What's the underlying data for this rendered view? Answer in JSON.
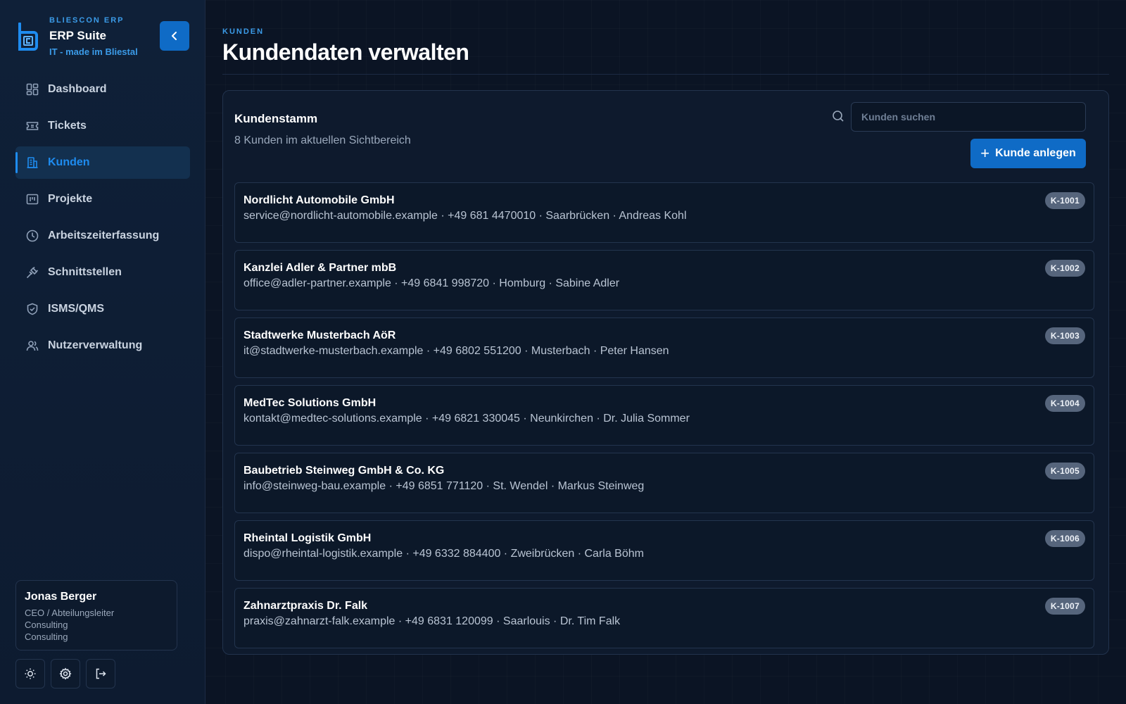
{
  "brand": {
    "company": "BLIESCON ERP",
    "product": "ERP Suite",
    "tagline": "IT - made im Bliestal"
  },
  "nav": {
    "items": [
      {
        "label": "Dashboard",
        "icon": "dashboard-grid-icon",
        "active": false
      },
      {
        "label": "Tickets",
        "icon": "ticket-icon",
        "active": false
      },
      {
        "label": "Kunden",
        "icon": "building-icon",
        "active": true
      },
      {
        "label": "Projekte",
        "icon": "project-board-icon",
        "active": false
      },
      {
        "label": "Arbeitszeiterfassung",
        "icon": "clock-icon",
        "active": false
      },
      {
        "label": "Schnittstellen",
        "icon": "plug-icon",
        "active": false
      },
      {
        "label": "ISMS/QMS",
        "icon": "shield-check-icon",
        "active": false
      },
      {
        "label": "Nutzerverwaltung",
        "icon": "users-icon",
        "active": false
      }
    ]
  },
  "user": {
    "name": "Jonas Berger",
    "role_line1": "CEO / Abteilungsleiter",
    "role_line2": "Consulting",
    "role_line3": "Consulting"
  },
  "footer_icons": [
    "sun-icon",
    "gear-icon",
    "logout-icon"
  ],
  "header": {
    "eyebrow": "KUNDEN",
    "title": "Kundendaten verwalten"
  },
  "panel": {
    "title": "Kundenstamm",
    "subtitle": "8 Kunden im aktuellen Sichtbereich",
    "search_placeholder": "Kunden suchen",
    "add_button": "Kunde anlegen"
  },
  "customers": [
    {
      "name": "Nordlicht Automobile GmbH",
      "meta": "service@nordlicht-automobile.example · +49 681 4470010 · Saarbrücken · Andreas Kohl",
      "id": "K-1001"
    },
    {
      "name": "Kanzlei Adler & Partner mbB",
      "meta": "office@adler-partner.example · +49 6841 998720 · Homburg · Sabine Adler",
      "id": "K-1002"
    },
    {
      "name": "Stadtwerke Musterbach AöR",
      "meta": "it@stadtwerke-musterbach.example · +49 6802 551200 · Musterbach · Peter Hansen",
      "id": "K-1003"
    },
    {
      "name": "MedTec Solutions GmbH",
      "meta": "kontakt@medtec-solutions.example · +49 6821 330045 · Neunkirchen · Dr. Julia Sommer",
      "id": "K-1004"
    },
    {
      "name": "Baubetrieb Steinweg GmbH & Co. KG",
      "meta": "info@steinweg-bau.example · +49 6851 771120 · St. Wendel · Markus Steinweg",
      "id": "K-1005"
    },
    {
      "name": "Rheintal Logistik GmbH",
      "meta": "dispo@rheintal-logistik.example · +49 6332 884400 · Zweibrücken · Carla Böhm",
      "id": "K-1006"
    },
    {
      "name": "Zahnarztpraxis Dr. Falk",
      "meta": "praxis@zahnarzt-falk.example · +49 6831 120099 · Saarlouis · Dr. Tim Falk",
      "id": "K-1007"
    }
  ],
  "colors": {
    "accent": "#0f6bc6",
    "accent_text": "#3b9be8",
    "background": "#0b1424",
    "badge": "#56657c"
  }
}
